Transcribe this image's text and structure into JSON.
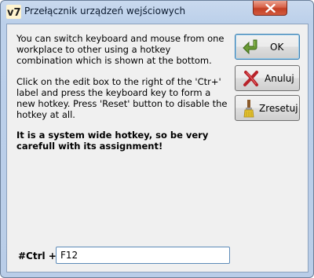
{
  "window": {
    "title": "Przełącznik urządzeń wejściowych",
    "app_icon_text": "v7"
  },
  "content": {
    "paragraph1": "You can switch keyboard and mouse from one workplace to other using a hotkey combination which is shown at the bottom.",
    "paragraph2": "Click on the edit box to the right of the 'Ctr+' label and press the keyboard key to form a new hotkey. Press 'Reset' button to disable the hotkey at all.",
    "warning": "It is a system wide hotkey, so be very carefull with its assignment!"
  },
  "buttons": {
    "ok": {
      "label": "OK",
      "icon": "green-return-arrow-icon"
    },
    "cancel": {
      "label": "Anuluj",
      "icon": "red-x-icon"
    },
    "reset": {
      "label": "Zresetuj",
      "icon": "brush-icon"
    }
  },
  "hotkey": {
    "label": "#Ctrl +",
    "value": "F12"
  },
  "colors": {
    "frame": "#bcd0ea",
    "client": "#f0f0f0",
    "close": "#c94a2f",
    "ok_icon": "#5a8a2c",
    "cancel_icon": "#b8232a"
  }
}
